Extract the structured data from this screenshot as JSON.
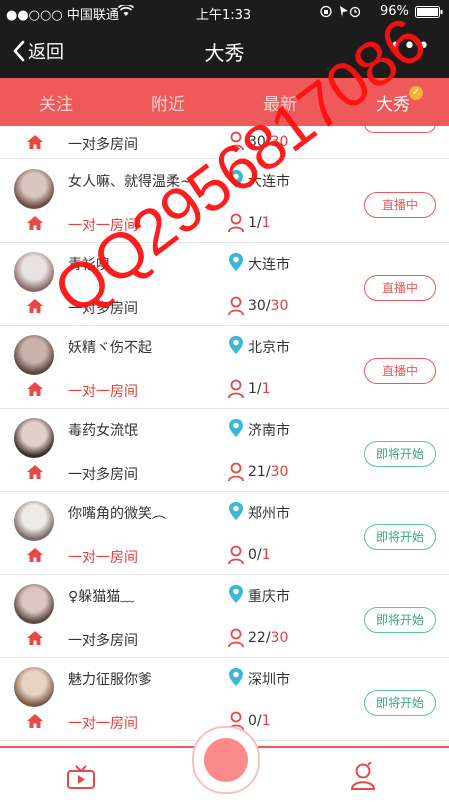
{
  "status_bar": {
    "carrier": "●●○○○ 中国联通",
    "time": "上午1:33",
    "battery": "96%"
  },
  "navbar": {
    "back_label": "返回",
    "title": "大秀",
    "more": "•••"
  },
  "tabs": [
    {
      "label": "关注",
      "active": false
    },
    {
      "label": "附近",
      "active": false
    },
    {
      "label": "最新",
      "active": false
    },
    {
      "label": "大秀",
      "active": true
    }
  ],
  "partial_row": {
    "room": "一对多房间",
    "current": "30",
    "max": "30"
  },
  "cards": [
    {
      "name": "女人嘛、就得温柔~",
      "city": "大连市",
      "room": "一对一房间",
      "room_red": true,
      "current": "1",
      "max": "1",
      "button": "直播中",
      "state": "live"
    },
    {
      "name": "青衫嗅",
      "city": "大连市",
      "room": "一对多房间",
      "room_red": false,
      "current": "30",
      "max": "30",
      "button": "直播中",
      "state": "live"
    },
    {
      "name": "妖精ヾ伤不起",
      "city": "北京市",
      "room": "一对一房间",
      "room_red": true,
      "current": "1",
      "max": "1",
      "button": "直播中",
      "state": "live"
    },
    {
      "name": "毒药女流氓",
      "city": "济南市",
      "room": "一对多房间",
      "room_red": false,
      "current": "21",
      "max": "30",
      "button": "即将开始",
      "state": "soon"
    },
    {
      "name": "你嘴角的微笑︵",
      "city": "郑州市",
      "room": "一对一房间",
      "room_red": true,
      "current": "0",
      "max": "1",
      "button": "即将开始",
      "state": "soon"
    },
    {
      "name": "♀躲猫猫﹏",
      "city": "重庆市",
      "room": "一对多房间",
      "room_red": false,
      "current": "22",
      "max": "30",
      "button": "即将开始",
      "state": "soon"
    },
    {
      "name": "魅力征服你爹",
      "city": "深圳市",
      "room": "一对一房间",
      "room_red": true,
      "current": "0",
      "max": "1",
      "button": "即将开始",
      "state": "soon"
    }
  ],
  "watermark": "QQ2956817086",
  "colors": {
    "accent": "#f0595a",
    "live": "#e95c5c",
    "soon": "#5cc49c",
    "location": "#3bb8d6"
  }
}
